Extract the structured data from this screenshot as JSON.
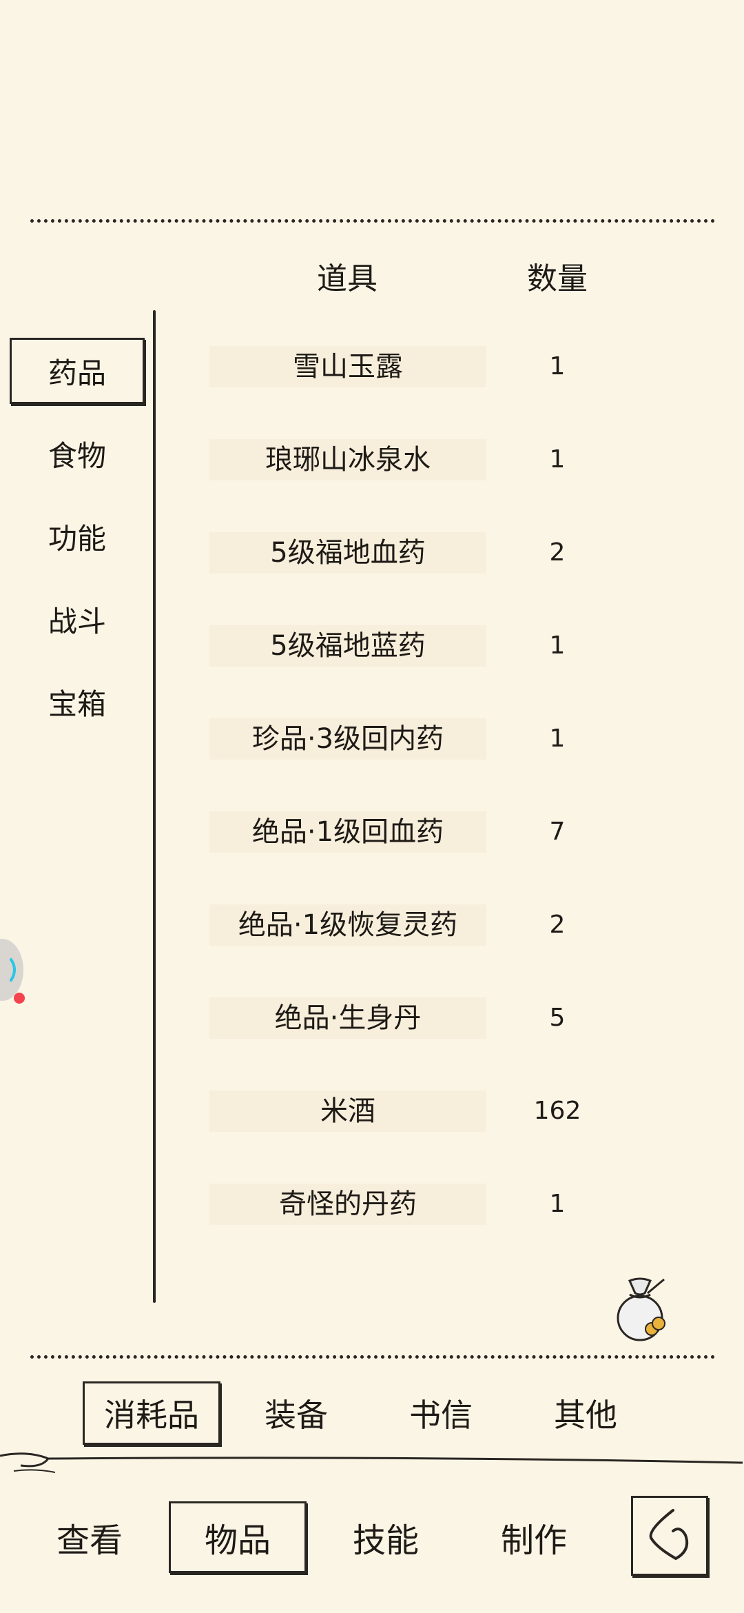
{
  "inventory": {
    "header": {
      "item_label": "道具",
      "qty_label": "数量"
    },
    "categories": [
      "药品",
      "食物",
      "功能",
      "战斗",
      "宝箱"
    ],
    "selected_category": "药品",
    "items": [
      {
        "name": "雪山玉露",
        "qty": "1"
      },
      {
        "name": "琅琊山冰泉水",
        "qty": "1"
      },
      {
        "name": "5级福地血药",
        "qty": "2"
      },
      {
        "name": "5级福地蓝药",
        "qty": "1"
      },
      {
        "name": "珍品·3级回内药",
        "qty": "1"
      },
      {
        "name": "绝品·1级回血药",
        "qty": "7"
      },
      {
        "name": "绝品·1级恢复灵药",
        "qty": "2"
      },
      {
        "name": "绝品·生身丹",
        "qty": "5"
      },
      {
        "name": "米酒",
        "qty": "162"
      },
      {
        "name": "奇怪的丹药",
        "qty": "1"
      }
    ]
  },
  "sub_tabs": [
    "消耗品",
    "装备",
    "书信",
    "其他"
  ],
  "selected_sub_tab": "消耗品",
  "bottom_nav": [
    "查看",
    "物品",
    "技能",
    "制作"
  ],
  "selected_nav": "物品",
  "icons": {
    "bag": "loot-bag-icon",
    "back": "back-icon",
    "floating": "floating-assistant-icon"
  },
  "colors": {
    "background": "#fbf5e6",
    "ink": "#2a2622",
    "row_bg": "#f7efdc",
    "notification_dot": "#f2434f",
    "floating_accent": "#28c6e6"
  }
}
